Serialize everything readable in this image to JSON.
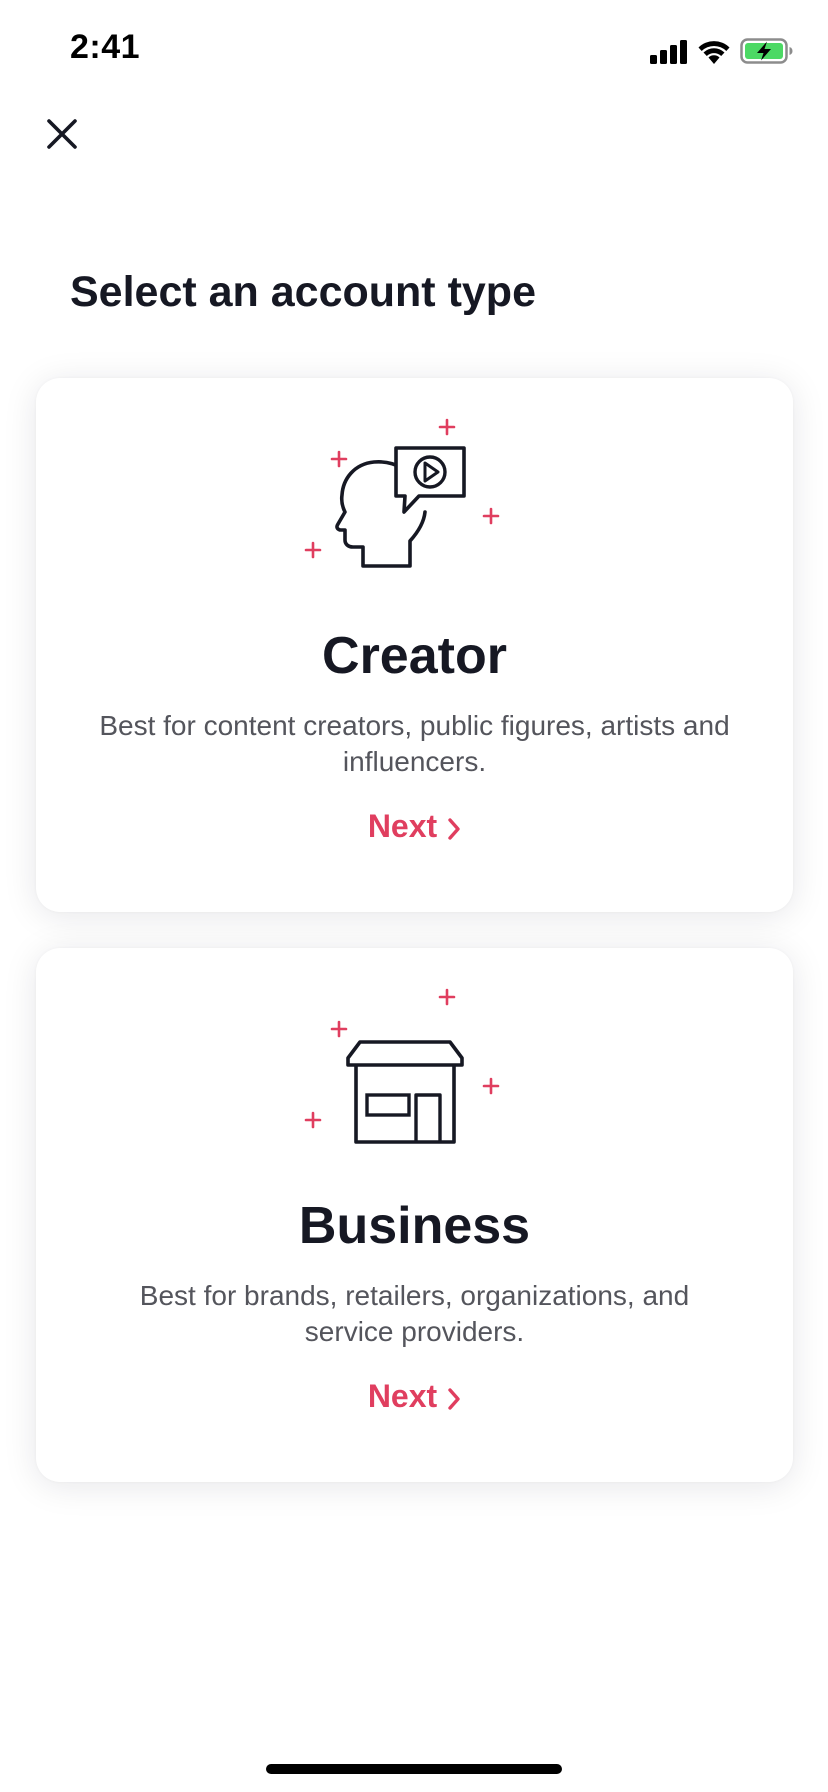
{
  "status_bar": {
    "time": "2:41"
  },
  "header": {
    "close_icon": "close-icon"
  },
  "page": {
    "title": "Select an account type"
  },
  "cards": [
    {
      "icon": "creator-head-video-icon",
      "title": "Creator",
      "description": "Best for content creators, public figures, artists and influencers.",
      "next_label": "Next"
    },
    {
      "icon": "storefront-icon",
      "title": "Business",
      "description": "Best for brands, retailers, organizations, and service providers.",
      "next_label": "Next"
    }
  ],
  "colors": {
    "accent": "#e03e5f",
    "text_primary": "#161823",
    "text_secondary": "#54555c",
    "battery_green": "#4cd964"
  }
}
